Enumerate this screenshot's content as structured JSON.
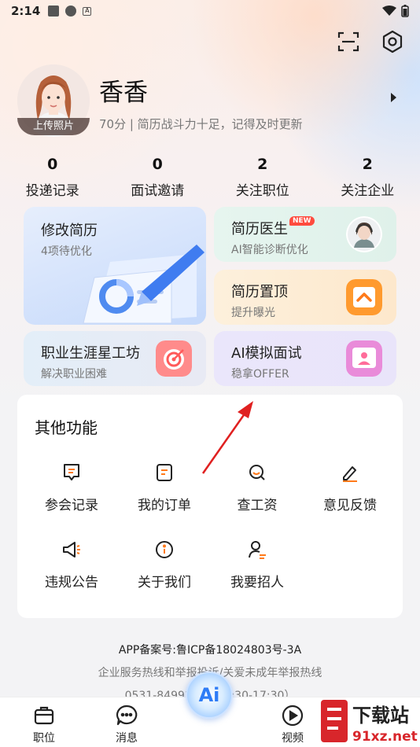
{
  "status_bar": {
    "time": "2:14"
  },
  "profile": {
    "name": "香香",
    "upload_label": "上传照片",
    "description": "70分 | 简历战斗力十足，记得及时更新"
  },
  "stats": [
    {
      "value": "0",
      "label": "投递记录"
    },
    {
      "value": "0",
      "label": "面试邀请"
    },
    {
      "value": "2",
      "label": "关注职位"
    },
    {
      "value": "2",
      "label": "关注企业"
    }
  ],
  "cards": {
    "resume_edit": {
      "title": "修改简历",
      "subtitle": "4项待优化"
    },
    "resume_doctor": {
      "title": "简历医生",
      "subtitle": "AI智能诊断优化",
      "badge": "NEW"
    },
    "resume_top": {
      "title": "简历置顶",
      "subtitle": "提升曝光"
    },
    "career": {
      "title": "职业生涯星工坊",
      "subtitle": "解决职业困难"
    },
    "ai_interview": {
      "title": "AI模拟面试",
      "subtitle": "稳拿OFFER"
    }
  },
  "other_functions": {
    "title": "其他功能",
    "items": [
      {
        "label": "参会记录",
        "icon": "chat-record-icon"
      },
      {
        "label": "我的订单",
        "icon": "order-icon"
      },
      {
        "label": "查工资",
        "icon": "salary-search-icon"
      },
      {
        "label": "意见反馈",
        "icon": "feedback-pen-icon"
      },
      {
        "label": "违规公告",
        "icon": "megaphone-icon"
      },
      {
        "label": "关于我们",
        "icon": "info-icon"
      },
      {
        "label": "我要招人",
        "icon": "recruit-person-icon"
      }
    ]
  },
  "footer": {
    "icp": "APP备案号:鲁ICP备18024803号-3A",
    "hotline": "企业服务热线和举报投诉/关爱未成年举报热线",
    "phone_partial": "0531-84992570（8:30-17:30）"
  },
  "tabbar": {
    "items": [
      {
        "label": "职位",
        "icon": "briefcase-icon"
      },
      {
        "label": "消息",
        "icon": "message-icon"
      },
      {
        "label": "视频",
        "icon": "video-icon"
      }
    ],
    "ai_label": "Ai"
  },
  "watermark": {
    "text_top": "下载站",
    "text_bottom": "91xz.net"
  },
  "colors": {
    "accent_orange": "#ff7a1a",
    "accent_blue": "#2e7cf6",
    "arrow_red": "#e02020"
  }
}
